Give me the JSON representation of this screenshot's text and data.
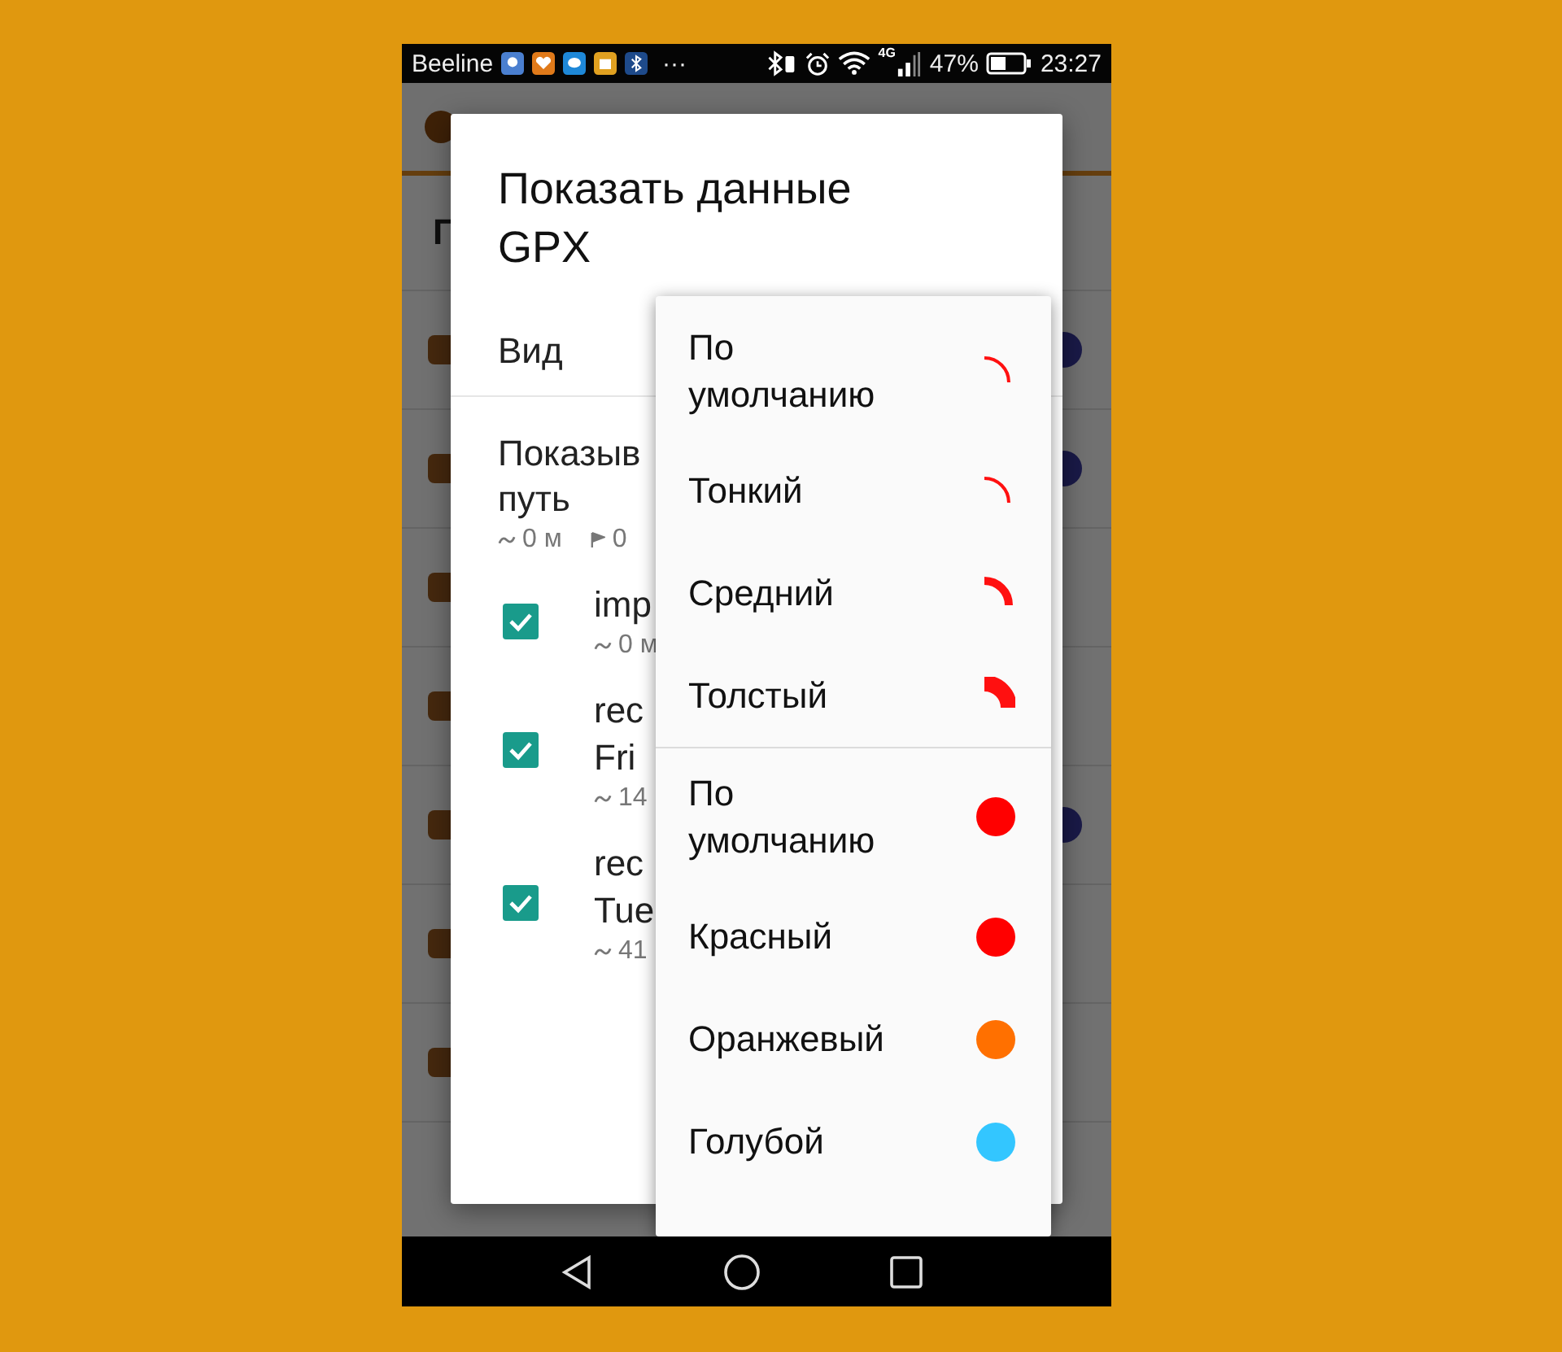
{
  "status_bar": {
    "carrier": "Beeline",
    "more": "···",
    "network": "4G",
    "battery": "47%",
    "time": "23:27"
  },
  "background_app": {
    "section_title": "Г"
  },
  "dialog": {
    "title": "Показать данные GPX",
    "view_label": "Вид",
    "show_track": {
      "lines": [
        "Показыв",
        "путь"
      ],
      "distance": "0 м",
      "points": "0"
    },
    "tracks": [
      {
        "lines": [
          "imp"
        ],
        "distance": "0 м",
        "checked": true
      },
      {
        "lines": [
          "rec",
          "Fri"
        ],
        "distance": "14",
        "checked": true
      },
      {
        "lines": [
          "rec",
          "Tue"
        ],
        "distance": "41",
        "checked": true
      }
    ]
  },
  "menu": {
    "sections": [
      {
        "items": [
          {
            "kind": "thin",
            "label": "По умолчанию"
          },
          {
            "kind": "thin",
            "label": "Тонкий"
          },
          {
            "kind": "medium",
            "label": "Средний"
          },
          {
            "kind": "thick",
            "label": "Толстый"
          }
        ]
      },
      {
        "items": [
          {
            "kind": "color",
            "label": "По умолчанию",
            "color": "#ff0000"
          },
          {
            "kind": "color",
            "label": "Красный",
            "color": "#ff0000"
          },
          {
            "kind": "color",
            "label": "Оранжевый",
            "color": "#ff7000"
          },
          {
            "kind": "color",
            "label": "Голубой",
            "color": "#33c6ff"
          }
        ]
      }
    ]
  }
}
